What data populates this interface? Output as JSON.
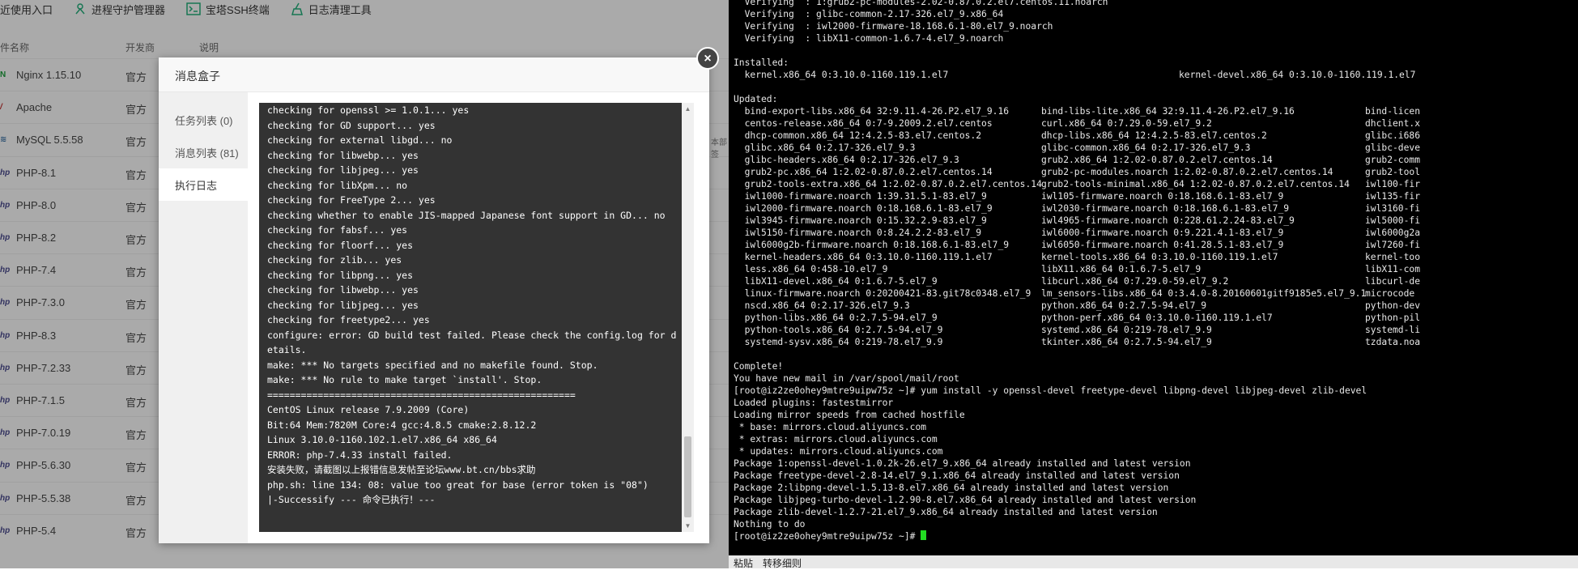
{
  "toolbar": {
    "items": [
      "近使用入口",
      "进程守护管理器",
      "宝塔SSH终端",
      "日志清理工具"
    ]
  },
  "table": {
    "headers": [
      "件名称",
      "开发商",
      "说明"
    ],
    "rows": [
      {
        "name": "Nginx 1.15.10",
        "developer": "官方"
      },
      {
        "name": "Apache",
        "developer": "官方"
      },
      {
        "name": "MySQL 5.5.58",
        "developer": "官方"
      },
      {
        "name": "PHP-8.1",
        "developer": "官方"
      },
      {
        "name": "PHP-8.0",
        "developer": "官方"
      },
      {
        "name": "PHP-8.2",
        "developer": "官方"
      },
      {
        "name": "PHP-7.4",
        "developer": "官方"
      },
      {
        "name": "PHP-7.3.0",
        "developer": "官方"
      },
      {
        "name": "PHP-8.3",
        "developer": "官方"
      },
      {
        "name": "PHP-7.2.33",
        "developer": "官方"
      },
      {
        "name": "PHP-7.1.5",
        "developer": "官方"
      },
      {
        "name": "PHP-7.0.19",
        "developer": "官方"
      },
      {
        "name": "PHP-5.6.30",
        "developer": "官方"
      },
      {
        "name": "PHP-5.5.38",
        "developer": "官方"
      },
      {
        "name": "PHP-5.4",
        "developer": "官方"
      }
    ],
    "side_text": "本部签"
  },
  "modal": {
    "title": "消息盒子",
    "close": "×",
    "nav": [
      "任务列表 (0)",
      "消息列表 (81)",
      "执行日志"
    ],
    "log_lines": [
      "checking for openssl >= 1.0.1... yes",
      "checking for GD support... yes",
      "checking for external libgd... no",
      "checking for libwebp... yes",
      "checking for libjpeg... yes",
      "checking for libXpm... no",
      "checking for FreeType 2... yes",
      "checking whether to enable JIS-mapped Japanese font support in GD... no",
      "checking for fabsf... yes",
      "checking for floorf... yes",
      "checking for zlib... yes",
      "checking for libpng... yes",
      "checking for libwebp... yes",
      "checking for libjpeg... yes",
      "checking for freetype2... yes",
      "configure: error: GD build test failed. Please check the config.log for details.",
      "make: *** No targets specified and no makefile found. Stop.",
      "make: *** No rule to make target `install'. Stop.",
      "=======================================================",
      "CentOS Linux release 7.9.2009 (Core)",
      "Bit:64 Mem:7820M Core:4 gcc:4.8.5 cmake:2.8.12.2",
      "Linux 3.10.0-1160.102.1.el7.x86_64 x86_64",
      "ERROR: php-7.4.33 install failed.",
      "安装失败，请截图以上报错信息发帖至论坛www.bt.cn/bbs求助",
      "php.sh: line 134: 08: value too great for base (error token is \"08\")",
      "|-Successify --- 命令已执行！---"
    ]
  },
  "terminal": {
    "lines_top": [
      "  Verifying  : 1:grub2-pc-modules-2.02-0.87.0.2.el7.centos.11.noarch",
      "  Verifying  : glibc-common-2.17-326.el7_9.x86_64",
      "  Verifying  : iwl2000-firmware-18.168.6.1-80.el7_9.noarch",
      "  Verifying  : libX11-common-1.6.7-4.el7_9.noarch",
      "",
      "Installed:"
    ],
    "installed": [
      "  kernel.x86_64 0:3.10.0-1160.119.1.el7",
      "kernel-devel.x86_64 0:3.10.0-1160.119.1.el7"
    ],
    "updated_label": "Updated:",
    "updated_rows": [
      [
        "  bind-export-libs.x86_64 32:9.11.4-26.P2.el7_9.16",
        "bind-libs-lite.x86_64 32:9.11.4-26.P2.el7_9.16",
        "bind-licen"
      ],
      [
        "  centos-release.x86_64 0:7-9.2009.2.el7.centos",
        "curl.x86_64 0:7.29.0-59.el7_9.2",
        "dhclient.x"
      ],
      [
        "  dhcp-common.x86_64 12:4.2.5-83.el7.centos.2",
        "dhcp-libs.x86_64 12:4.2.5-83.el7.centos.2",
        "glibc.i686"
      ],
      [
        "  glibc.x86_64 0:2.17-326.el7_9.3",
        "glibc-common.x86_64 0:2.17-326.el7_9.3",
        "glibc-deve"
      ],
      [
        "  glibc-headers.x86_64 0:2.17-326.el7_9.3",
        "grub2.x86_64 1:2.02-0.87.0.2.el7.centos.14",
        "grub2-comm"
      ],
      [
        "  grub2-pc.x86_64 1:2.02-0.87.0.2.el7.centos.14",
        "grub2-pc-modules.noarch 1:2.02-0.87.0.2.el7.centos.14",
        "grub2-tool"
      ],
      [
        "  grub2-tools-extra.x86_64 1:2.02-0.87.0.2.el7.centos.14",
        "grub2-tools-minimal.x86_64 1:2.02-0.87.0.2.el7.centos.14",
        "iwl100-fir"
      ],
      [
        "  iwl1000-firmware.noarch 1:39.31.5.1-83.el7_9",
        "iwl105-firmware.noarch 0:18.168.6.1-83.el7_9",
        "iwl135-fir"
      ],
      [
        "  iwl2000-firmware.noarch 0:18.168.6.1-83.el7_9",
        "iwl2030-firmware.noarch 0:18.168.6.1-83.el7_9",
        "iwl3160-fi"
      ],
      [
        "  iwl3945-firmware.noarch 0:15.32.2.9-83.el7_9",
        "iwl4965-firmware.noarch 0:228.61.2.24-83.el7_9",
        "iwl5000-fi"
      ],
      [
        "  iwl5150-firmware.noarch 0:8.24.2.2-83.el7_9",
        "iwl6000-firmware.noarch 0:9.221.4.1-83.el7_9",
        "iwl6000g2a"
      ],
      [
        "  iwl6000g2b-firmware.noarch 0:18.168.6.1-83.el7_9",
        "iwl6050-firmware.noarch 0:41.28.5.1-83.el7_9",
        "iwl7260-fi"
      ],
      [
        "  kernel-headers.x86_64 0:3.10.0-1160.119.1.el7",
        "kernel-tools.x86_64 0:3.10.0-1160.119.1.el7",
        "kernel-too"
      ],
      [
        "  less.x86_64 0:458-10.el7_9",
        "libX11.x86_64 0:1.6.7-5.el7_9",
        "libX11-com"
      ],
      [
        "  libX11-devel.x86_64 0:1.6.7-5.el7_9",
        "libcurl.x86_64 0:7.29.0-59.el7_9.2",
        "libcurl-de"
      ],
      [
        "  linux-firmware.noarch 0:20200421-83.git78c0348.el7_9",
        "lm_sensors-libs.x86_64 0:3.4.0-8.20160601gitf9185e5.el7_9.1",
        "microcode"
      ],
      [
        "  nscd.x86_64 0:2.17-326.el7_9.3",
        "python.x86_64 0:2.7.5-94.el7_9",
        "python-dev"
      ],
      [
        "  python-libs.x86_64 0:2.7.5-94.el7_9",
        "python-perf.x86_64 0:3.10.0-1160.119.1.el7",
        "python-pil"
      ],
      [
        "  python-tools.x86_64 0:2.7.5-94.el7_9",
        "systemd.x86_64 0:219-78.el7_9.9",
        "systemd-li"
      ],
      [
        "  systemd-sysv.x86_64 0:219-78.el7_9.9",
        "tkinter.x86_64 0:2.7.5-94.el7_9",
        "tzdata.noa"
      ]
    ],
    "lines_bottom": [
      "",
      "Complete!",
      "You have new mail in /var/spool/mail/root",
      "[root@iz2ze0ohey9mtre9uipw75z ~]# yum install -y openssl-devel freetype-devel libpng-devel libjpeg-devel zlib-devel",
      "Loaded plugins: fastestmirror",
      "Loading mirror speeds from cached hostfile",
      " * base: mirrors.cloud.aliyuncs.com",
      " * extras: mirrors.cloud.aliyuncs.com",
      " * updates: mirrors.cloud.aliyuncs.com",
      "Package 1:openssl-devel-1.0.2k-26.el7_9.x86_64 already installed and latest version",
      "Package freetype-devel-2.8-14.el7_9.1.x86_64 already installed and latest version",
      "Package 2:libpng-devel-1.5.13-8.el7.x86_64 already installed and latest version",
      "Package libjpeg-turbo-devel-1.2.90-8.el7.x86_64 already installed and latest version",
      "Package zlib-devel-1.2.7-21.el7_9.x86_64 already installed and latest version",
      "Nothing to do"
    ],
    "prompt": "[root@iz2ze0ohey9mtre9uipw75z ~]# ",
    "footer_left": "粘贴",
    "footer_right": "转移细则"
  },
  "colors": {
    "terminal_bg": "#000000",
    "cursor": "#22dd22",
    "console_bg": "#333333",
    "overlay": "rgba(0,0,0,0.30)"
  }
}
